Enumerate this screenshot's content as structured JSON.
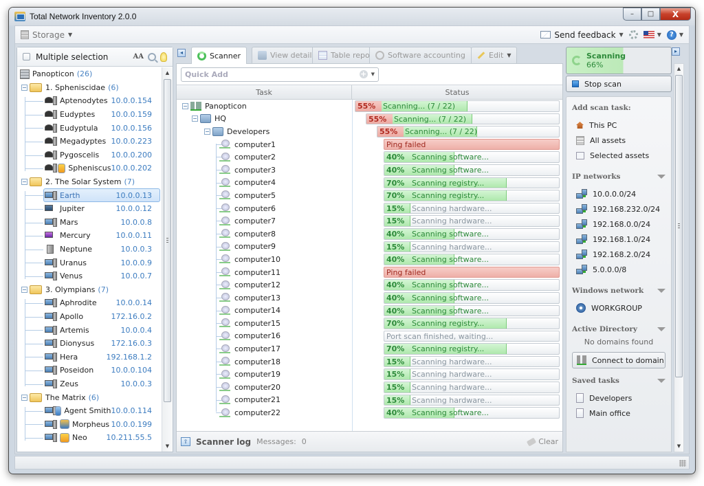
{
  "window": {
    "title": "Total Network Inventory 2.0.0",
    "controls": {
      "minimize": "–",
      "maximize": "□",
      "close": "X"
    }
  },
  "menubar": {
    "storage_label": "Storage",
    "send_feedback_label": "Send feedback",
    "icons": [
      "mail-icon",
      "gear-icon",
      "flag-us-icon",
      "help-icon"
    ]
  },
  "left_panel": {
    "multiple_selection_label": "Multiple selection",
    "multiple_selection_checked": false,
    "font_toggle_label": "AA",
    "root": {
      "name": "Panopticon",
      "count": "(26)"
    },
    "groups": [
      {
        "name": "1. Spheniscidae",
        "count": "(6)",
        "items": [
          {
            "name": "Aptenodytes",
            "ip": "10.0.0.154",
            "icon": "linux-server"
          },
          {
            "name": "Eudyptes",
            "ip": "10.0.0.159",
            "icon": "linux-desktop"
          },
          {
            "name": "Eudyptula",
            "ip": "10.0.0.156",
            "icon": "linux-desktop"
          },
          {
            "name": "Megadyptes",
            "ip": "10.0.0.223",
            "icon": "linux-laptop"
          },
          {
            "name": "Pygoscelis",
            "ip": "10.0.0.200",
            "icon": "linux-server"
          },
          {
            "name": "Spheniscus",
            "ip": "10.0.0.202",
            "icon": "linux-vm"
          }
        ]
      },
      {
        "name": "2. The Solar System",
        "count": "(7)",
        "items": [
          {
            "name": "Earth",
            "ip": "10.0.0.13",
            "icon": "windows-desktop",
            "selected": true
          },
          {
            "name": "Jupiter",
            "ip": "10.0.0.12",
            "icon": "laptop"
          },
          {
            "name": "Mars",
            "ip": "10.0.0.8",
            "icon": "windows-desktop"
          },
          {
            "name": "Mercury",
            "ip": "10.0.0.11",
            "icon": "mac"
          },
          {
            "name": "Neptune",
            "ip": "10.0.0.3",
            "icon": "server"
          },
          {
            "name": "Uranus",
            "ip": "10.0.0.9",
            "icon": "windows-desktop"
          },
          {
            "name": "Venus",
            "ip": "10.0.0.7",
            "icon": "windows-desktop"
          }
        ]
      },
      {
        "name": "3. Olympians",
        "count": "(7)",
        "items": [
          {
            "name": "Aphrodite",
            "ip": "10.0.0.14",
            "icon": "windows-desktop"
          },
          {
            "name": "Apollo",
            "ip": "172.16.0.2",
            "icon": "windows-desktop"
          },
          {
            "name": "Artemis",
            "ip": "10.0.0.4",
            "icon": "windows-desktop"
          },
          {
            "name": "Dionysus",
            "ip": "172.16.0.3",
            "icon": "windows-desktop"
          },
          {
            "name": "Hera",
            "ip": "192.168.1.2",
            "icon": "windows-desktop"
          },
          {
            "name": "Poseidon",
            "ip": "10.0.0.104",
            "icon": "windows-desktop"
          },
          {
            "name": "Zeus",
            "ip": "10.0.0.3",
            "icon": "windows-desktop"
          }
        ]
      },
      {
        "name": "The Matrix",
        "count": "(6)",
        "items": [
          {
            "name": "Agent Smith",
            "ip": "10.0.0.114",
            "icon": "windows-vm-monitor"
          },
          {
            "name": "Morpheus",
            "ip": "10.0.0.199",
            "icon": "windows-vm-blue"
          },
          {
            "name": "Neo",
            "ip": "10.211.55.5",
            "icon": "windows-vm-orange"
          }
        ]
      }
    ]
  },
  "tabs": [
    {
      "label": "Scanner",
      "active": true,
      "icon": "scanner-ring-icon"
    },
    {
      "label": "View details",
      "active": false,
      "icon": "view-details-icon"
    },
    {
      "label": "Table report",
      "active": false,
      "icon": "table-icon"
    },
    {
      "label": "Software accounting",
      "active": false,
      "icon": "link-icon"
    },
    {
      "label": "Edit",
      "active": false,
      "icon": "pencil-icon"
    }
  ],
  "scanner": {
    "quick_add_placeholder": "Quick Add",
    "columns": {
      "task": "Task",
      "status": "Status"
    },
    "tasks": [
      {
        "name": "Panopticon",
        "level": 0,
        "type": "network",
        "progress": 55,
        "status": "Scanning... (7 / 22)",
        "kind": "group"
      },
      {
        "name": "HQ",
        "level": 1,
        "type": "group",
        "progress": 55,
        "status": "Scanning... (7 / 22)",
        "kind": "group"
      },
      {
        "name": "Developers",
        "level": 2,
        "type": "group",
        "progress": 55,
        "status": "Scanning... (7 / 22)",
        "kind": "group"
      },
      {
        "name": "computer1",
        "level": 3,
        "progress": null,
        "status": "Ping failed",
        "kind": "fail"
      },
      {
        "name": "computer2",
        "level": 3,
        "progress": 40,
        "status": "Scanning software...",
        "kind": "scan"
      },
      {
        "name": "computer3",
        "level": 3,
        "progress": 40,
        "status": "Scanning software...",
        "kind": "scan"
      },
      {
        "name": "computer4",
        "level": 3,
        "progress": 70,
        "status": "Scanning registry...",
        "kind": "scan"
      },
      {
        "name": "computer5",
        "level": 3,
        "progress": 70,
        "status": "Scanning registry...",
        "kind": "scan"
      },
      {
        "name": "computer6",
        "level": 3,
        "progress": 15,
        "status": "Scanning hardware...",
        "kind": "scan"
      },
      {
        "name": "computer7",
        "level": 3,
        "progress": 15,
        "status": "Scanning hardware...",
        "kind": "scan"
      },
      {
        "name": "computer8",
        "level": 3,
        "progress": 40,
        "status": "Scanning software...",
        "kind": "scan"
      },
      {
        "name": "computer9",
        "level": 3,
        "progress": 15,
        "status": "Scanning hardware...",
        "kind": "scan"
      },
      {
        "name": "computer10",
        "level": 3,
        "progress": 40,
        "status": "Scanning software...",
        "kind": "scan"
      },
      {
        "name": "computer11",
        "level": 3,
        "progress": null,
        "status": "Ping failed",
        "kind": "fail"
      },
      {
        "name": "computer12",
        "level": 3,
        "progress": 40,
        "status": "Scanning software...",
        "kind": "scan"
      },
      {
        "name": "computer13",
        "level": 3,
        "progress": 40,
        "status": "Scanning software...",
        "kind": "scan"
      },
      {
        "name": "computer14",
        "level": 3,
        "progress": 40,
        "status": "Scanning software...",
        "kind": "scan"
      },
      {
        "name": "computer15",
        "level": 3,
        "progress": 70,
        "status": "Scanning registry...",
        "kind": "scan"
      },
      {
        "name": "computer16",
        "level": 3,
        "progress": null,
        "status": "Port scan finished, waiting...",
        "kind": "wait"
      },
      {
        "name": "computer17",
        "level": 3,
        "progress": 70,
        "status": "Scanning registry...",
        "kind": "scan"
      },
      {
        "name": "computer18",
        "level": 3,
        "progress": 15,
        "status": "Scanning hardware...",
        "kind": "scan"
      },
      {
        "name": "computer19",
        "level": 3,
        "progress": 15,
        "status": "Scanning hardware...",
        "kind": "scan"
      },
      {
        "name": "computer20",
        "level": 3,
        "progress": 15,
        "status": "Scanning hardware...",
        "kind": "scan"
      },
      {
        "name": "computer21",
        "level": 3,
        "progress": 15,
        "status": "Scanning hardware...",
        "kind": "scan"
      },
      {
        "name": "computer22",
        "level": 3,
        "progress": 40,
        "status": "Scanning software...",
        "kind": "scan"
      }
    ],
    "log": {
      "title": "Scanner log",
      "messages_label": "Messages:",
      "messages_count": "0",
      "clear_label": "Clear"
    }
  },
  "right_panel": {
    "scanning": {
      "title": "Scanning",
      "percent_label": "66%",
      "progress": 66
    },
    "stop_scan_label": "Stop scan",
    "add_scan_task": {
      "title": "Add scan task:",
      "items": [
        "This PC",
        "All assets",
        "Selected assets"
      ]
    },
    "ip_networks": {
      "title": "IP networks",
      "items": [
        "10.0.0.0/24",
        "192.168.232.0/24",
        "192.168.0.0/24",
        "192.168.1.0/24",
        "192.168.2.0/24",
        "5.0.0.0/8"
      ]
    },
    "windows_network": {
      "title": "Windows network",
      "items": [
        "WORKGROUP"
      ]
    },
    "active_directory": {
      "title": "Active Directory",
      "empty_text": "No domains found",
      "connect_label": "Connect to domain"
    },
    "saved_tasks": {
      "title": "Saved tasks",
      "items": [
        "Developers",
        "Main office"
      ]
    }
  },
  "colors": {
    "progress_green": "#aee8ac",
    "progress_text_green": "#2d8a3a",
    "fail_red": "#eeb0a8",
    "ip_blue": "#3c7cc0"
  }
}
